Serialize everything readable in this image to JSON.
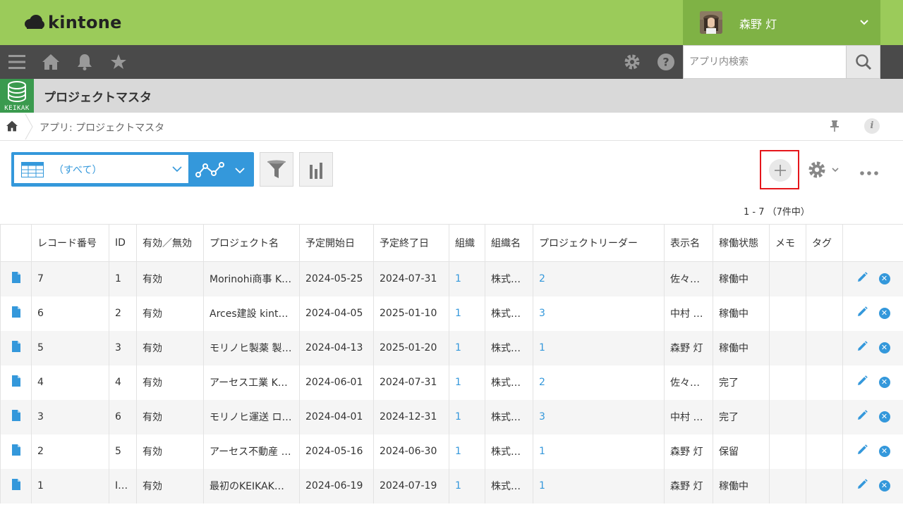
{
  "header": {
    "logo_text": "kintone",
    "user_name": "森野 灯"
  },
  "nav": {
    "search_placeholder": "アプリ内検索"
  },
  "app": {
    "icon_label": "KEIKAK",
    "title": "プロジェクトマスタ"
  },
  "breadcrumb": {
    "text": "アプリ: プロジェクトマスタ"
  },
  "toolbar": {
    "view_label": "（すべて）",
    "pager": "1 - 7 （7件中）"
  },
  "table": {
    "columns": [
      "レコード番号",
      "ID",
      "有効／無効",
      "プロジェクト名",
      "予定開始日",
      "予定終了日",
      "組織",
      "組織名",
      "プロジェクトリーダー",
      "表示名",
      "稼働状態",
      "メモ",
      "タグ"
    ],
    "rows": [
      [
        "7",
        "1",
        "有効",
        "Morinohi商事 K…",
        "2024-05-25",
        "2024-07-31",
        "1",
        "株式…",
        "2",
        "佐々…",
        "稼働中",
        "",
        ""
      ],
      [
        "6",
        "2",
        "有効",
        "Arces建設 kinto…",
        "2024-04-05",
        "2025-01-10",
        "1",
        "株式…",
        "3",
        "中村 …",
        "稼働中",
        "",
        ""
      ],
      [
        "5",
        "3",
        "有効",
        "モリノヒ製薬 製…",
        "2024-04-13",
        "2025-01-20",
        "1",
        "株式…",
        "1",
        "森野 灯",
        "稼働中",
        "",
        ""
      ],
      [
        "4",
        "4",
        "有効",
        "アーセス工業 KE…",
        "2024-06-01",
        "2024-07-31",
        "1",
        "株式…",
        "2",
        "佐々…",
        "完了",
        "",
        ""
      ],
      [
        "3",
        "6",
        "有効",
        "モリノヒ運送 ロ…",
        "2024-04-01",
        "2024-12-31",
        "1",
        "株式…",
        "3",
        "中村 …",
        "完了",
        "",
        ""
      ],
      [
        "2",
        "5",
        "有効",
        "アーセス不動産 …",
        "2024-05-16",
        "2024-06-30",
        "1",
        "株式…",
        "1",
        "森野 灯",
        "保留",
        "",
        ""
      ],
      [
        "1",
        "I…",
        "有効",
        "最初のKEIKAKプ…",
        "2024-06-19",
        "2024-07-19",
        "1",
        "株式…",
        "1",
        "森野 灯",
        "稼働中",
        "",
        ""
      ]
    ]
  },
  "colors": {
    "top_green": "#9bcb5a",
    "user_green": "#7fb245",
    "nav_dark": "#4a4a4a",
    "accent_blue": "#3498db",
    "highlight_red": "#e5161b"
  }
}
